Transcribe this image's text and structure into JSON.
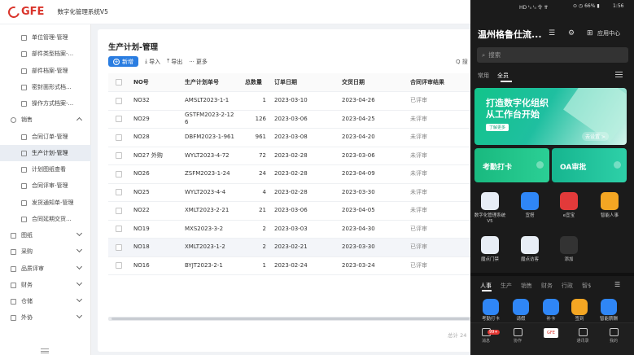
{
  "header": {
    "logo": "GFE",
    "system_name": "数字化管理系统V5"
  },
  "sidebar": {
    "items": [
      {
        "label": "单位管理-管理",
        "type": "sub",
        "active": false
      },
      {
        "label": "部件类型档案-...",
        "type": "sub",
        "active": false
      },
      {
        "label": "部件档案-管理",
        "type": "sub",
        "active": false
      },
      {
        "label": "密封面形式档...",
        "type": "sub",
        "active": false
      },
      {
        "label": "操作方式档案-...",
        "type": "sub",
        "active": false
      },
      {
        "label": "销售",
        "type": "group",
        "expanded": true
      },
      {
        "label": "合同订单-管理",
        "type": "sub",
        "active": false
      },
      {
        "label": "生产计划-管理",
        "type": "sub",
        "active": true
      },
      {
        "label": "计划图纸查看",
        "type": "sub",
        "active": false
      },
      {
        "label": "合同评审-管理",
        "type": "sub",
        "active": false
      },
      {
        "label": "发货通知单-管理",
        "type": "sub",
        "active": false
      },
      {
        "label": "合同延期交货...",
        "type": "sub",
        "active": false
      },
      {
        "label": "图纸",
        "type": "group",
        "expanded": false
      },
      {
        "label": "采购",
        "type": "group",
        "expanded": false
      },
      {
        "label": "品质评审",
        "type": "group",
        "expanded": false
      },
      {
        "label": "财务",
        "type": "group",
        "expanded": false
      },
      {
        "label": "仓储",
        "type": "group",
        "expanded": false
      },
      {
        "label": "外协",
        "type": "group",
        "expanded": false
      }
    ]
  },
  "main": {
    "title": "生产计划-管理",
    "toolbar": {
      "new": "新增",
      "import": "导入",
      "export": "导出",
      "more": "更多"
    },
    "search_hint": "Q 搜",
    "columns": [
      "NO号",
      "生产计划单号",
      "总数量",
      "订单日期",
      "交货日期",
      "合同评审结果"
    ],
    "rows": [
      {
        "no": "NO32",
        "plan": "AMSLT2023-1-1",
        "qty": "1",
        "order": "2023-03-10",
        "delivery": "2023-04-26",
        "review": "已评审"
      },
      {
        "no": "NO29",
        "plan": "GSTFM2023-2-126",
        "qty": "126",
        "order": "2023-03-06",
        "delivery": "2023-04-25",
        "review": "未评审"
      },
      {
        "no": "NO28",
        "plan": "DBFM2023-1-961",
        "qty": "961",
        "order": "2023-03-08",
        "delivery": "2023-04-20",
        "review": "未评审"
      },
      {
        "no": "NO27 外购",
        "plan": "WYLT2023-4-72",
        "qty": "72",
        "order": "2023-02-28",
        "delivery": "2023-03-06",
        "review": "未评审"
      },
      {
        "no": "NO26",
        "plan": "ZSFM2023-1-24",
        "qty": "24",
        "order": "2023-02-28",
        "delivery": "2023-04-09",
        "review": "未评审"
      },
      {
        "no": "NO25",
        "plan": "WYLT2023-4-4",
        "qty": "4",
        "order": "2023-02-28",
        "delivery": "2023-03-30",
        "review": "未评审"
      },
      {
        "no": "NO22",
        "plan": "XMLT2023-2-21",
        "qty": "21",
        "order": "2023-03-06",
        "delivery": "2023-04-05",
        "review": "未评审"
      },
      {
        "no": "NO19",
        "plan": "MXS2023-3-2",
        "qty": "2",
        "order": "2023-03-03",
        "delivery": "2023-04-30",
        "review": "已评审"
      },
      {
        "no": "NO18",
        "plan": "XMLT2023-1-2",
        "qty": "2",
        "order": "2023-02-21",
        "delivery": "2023-03-30",
        "review": "已评审"
      },
      {
        "no": "NO16",
        "plan": "BYJT2023-2-1",
        "qty": "1",
        "order": "2023-02-24",
        "delivery": "2023-03-24",
        "review": "已评审"
      }
    ],
    "selected_row": 8,
    "pager": "总计 24"
  },
  "phone": {
    "status_left": "HD ᵗᵢₗ ᵗᵢₗ 令 ⇈",
    "status_right": "⊙ ◷ 66% ▮",
    "time": "1:56",
    "title": "温州格鲁仕流...",
    "app_center": "应用中心",
    "search_placeholder": "搜索",
    "tabs": [
      "常用",
      "全员"
    ],
    "banner": {
      "line1": "打造数字化组织",
      "line2": "从工作台开始",
      "button": "了解更多",
      "right": "去设置 >"
    },
    "card_left": "考勤打卡",
    "card_right": "OA审批",
    "apps_row1": [
      {
        "label": "数字化管理系统V5",
        "color": "#e8eef6"
      },
      {
        "label": "宜搭",
        "color": "#2f86f6"
      },
      {
        "label": "e宜宝",
        "color": "#e23a3a"
      },
      {
        "label": "智能人事",
        "color": "#f4a623"
      }
    ],
    "apps_row2": [
      {
        "label": "魔点门禁",
        "color": "#e8eef6"
      },
      {
        "label": "魔点访客",
        "color": "#e8eef6"
      },
      {
        "label": "添加",
        "color": "#333333"
      }
    ],
    "category_tabs": [
      "人事",
      "生产",
      "销售",
      "财务",
      "行政",
      "智$"
    ],
    "quick_apps": [
      {
        "label": "考勤打卡",
        "color": "#2f86f6"
      },
      {
        "label": "请假",
        "color": "#2f86f6"
      },
      {
        "label": "补卡",
        "color": "#2f86f6"
      },
      {
        "label": "签到",
        "color": "#f4a623"
      },
      {
        "label": "智能薪酬",
        "color": "#2f86f6"
      }
    ],
    "nav": [
      {
        "label": "消息",
        "badge": "99+"
      },
      {
        "label": "协作"
      },
      {
        "label": "GFE"
      },
      {
        "label": "通讯录"
      },
      {
        "label": "我的"
      }
    ]
  }
}
